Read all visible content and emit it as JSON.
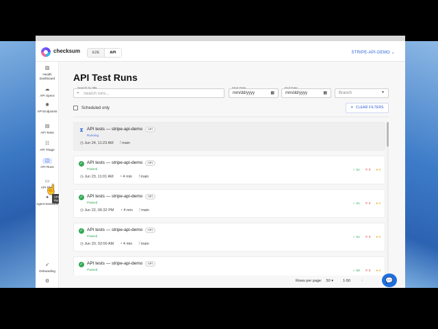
{
  "app": {
    "brand": "checksum",
    "tabs": [
      {
        "label": "E2E",
        "active": false
      },
      {
        "label": "API",
        "active": true
      }
    ],
    "project": "STRIPE-API-DEMO"
  },
  "sidebar": {
    "items": [
      {
        "label": "Health Dashboard",
        "icon": "chart-icon",
        "active": false
      },
      {
        "label": "API Specs",
        "icon": "cloud-icon",
        "active": false
      },
      {
        "label": "API Endpoints",
        "icon": "network-icon",
        "active": false
      },
      {
        "label": "API Tests",
        "icon": "list-icon",
        "active": false
      },
      {
        "label": "API Triage",
        "icon": "sliders-icon",
        "active": false
      },
      {
        "label": "API Runs",
        "icon": "runs-icon",
        "active": true
      },
      {
        "label": "API Files",
        "icon": "folder-icon",
        "active": false
      },
      {
        "label": "Agent Sessions",
        "icon": "sparkle-icon",
        "active": false
      },
      {
        "label": "Onboarding",
        "icon": "rocket-icon",
        "active": false
      },
      {
        "label": "",
        "icon": "gear-icon",
        "active": false
      }
    ],
    "tooltip": "API Runs"
  },
  "page": {
    "title": "API Test Runs",
    "search_label": "Search by title",
    "search_placeholder": "Search runs...",
    "start_date_label": "Start Date",
    "start_date_value": "mm/dd/yyyy",
    "end_date_label": "End Date",
    "end_date_value": "mm/dd/yyyy",
    "branch_placeholder": "Branch",
    "scheduled_label": "Scheduled only",
    "clear_filters": "CLEAR FILTERS"
  },
  "runs": [
    {
      "name": "API tests — stripe-api-demo",
      "badge": "API",
      "status": "Running",
      "date": "Jun 24, 11:23 AM",
      "duration": "",
      "branch": "main",
      "passed": "",
      "failed": "",
      "warn": ""
    },
    {
      "name": "API tests — stripe-api-demo",
      "badge": "API",
      "status": "Passed",
      "date": "Jun 23, 11:01 AM",
      "duration": "4 min",
      "branch": "main",
      "passed": "61",
      "failed": "0",
      "warn": "0"
    },
    {
      "name": "API tests — stripe-api-demo",
      "badge": "API",
      "status": "Passed",
      "date": "Jun 22, 06:32 PM",
      "duration": "4 min",
      "branch": "main",
      "passed": "61",
      "failed": "0",
      "warn": "0"
    },
    {
      "name": "API tests — stripe-api-demo",
      "badge": "API",
      "status": "Passed",
      "date": "Jun 20, 02:00 AM",
      "duration": "4 min",
      "branch": "main",
      "passed": "61",
      "failed": "0",
      "warn": "0"
    },
    {
      "name": "API tests — stripe-api-demo",
      "badge": "API",
      "status": "Passed",
      "date": "",
      "duration": "",
      "branch": "",
      "passed": "59",
      "failed": "0",
      "warn": "0"
    }
  ],
  "pager": {
    "rows_label": "Rows per page:",
    "rows_value": "50",
    "range": "1-50"
  },
  "colors": {
    "accent": "#2a55d6",
    "passed": "#33a853",
    "failed": "#d94040",
    "warning": "#e0a800"
  }
}
